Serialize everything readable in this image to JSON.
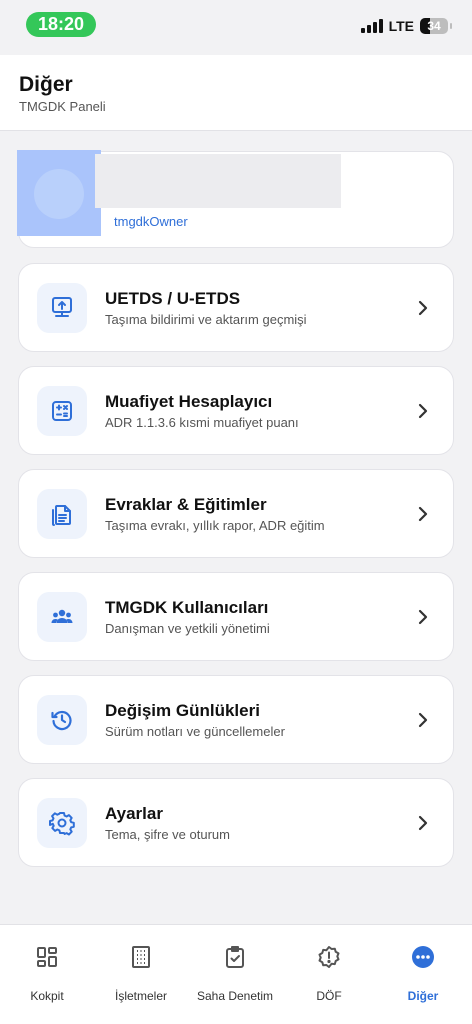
{
  "status_bar": {
    "time": "18:20",
    "network": "LTE",
    "battery": "34",
    "battery_level": 0.34,
    "time_bg": "#34c759"
  },
  "header": {
    "title": "Diğer",
    "subtitle": "TMGDK Paneli"
  },
  "profile": {
    "role": "tmgdkOwner",
    "name_redacted": true
  },
  "menu": [
    {
      "title": "UETDS / U-ETDS",
      "subtitle": "Taşıma bildirimi ve aktarım geçmişi",
      "icon": "upload-monitor-icon"
    },
    {
      "title": "Muafiyet Hesaplayıcı",
      "subtitle": "ADR 1.1.3.6 kısmi muafiyet puanı",
      "icon": "calculator-icon"
    },
    {
      "title": "Evraklar & Eğitimler",
      "subtitle": "Taşıma evrakı, yıllık rapor, ADR eğitim",
      "icon": "documents-icon"
    },
    {
      "title": "TMGDK Kullanıcıları",
      "subtitle": "Danışman ve yetkili yönetimi",
      "icon": "users-group-icon"
    },
    {
      "title": "Değişim Günlükleri",
      "subtitle": "Sürüm notları ve güncellemeler",
      "icon": "history-icon"
    },
    {
      "title": "Ayarlar",
      "subtitle": "Tema, şifre ve oturum",
      "icon": "gear-icon"
    }
  ],
  "tabs": [
    {
      "label": "Kokpit",
      "icon": "dashboard-icon"
    },
    {
      "label": "İşletmeler",
      "icon": "building-icon"
    },
    {
      "label": "Saha Denetim",
      "icon": "clipboard-check-icon"
    },
    {
      "label": "DÖF",
      "icon": "alert-badge-icon"
    },
    {
      "label": "Diğer",
      "icon": "more-icon",
      "active": true
    }
  ],
  "colors": {
    "accent": "#2f6fd8",
    "icon_bg": "#eef3fc",
    "background": "#f2f2f4"
  }
}
